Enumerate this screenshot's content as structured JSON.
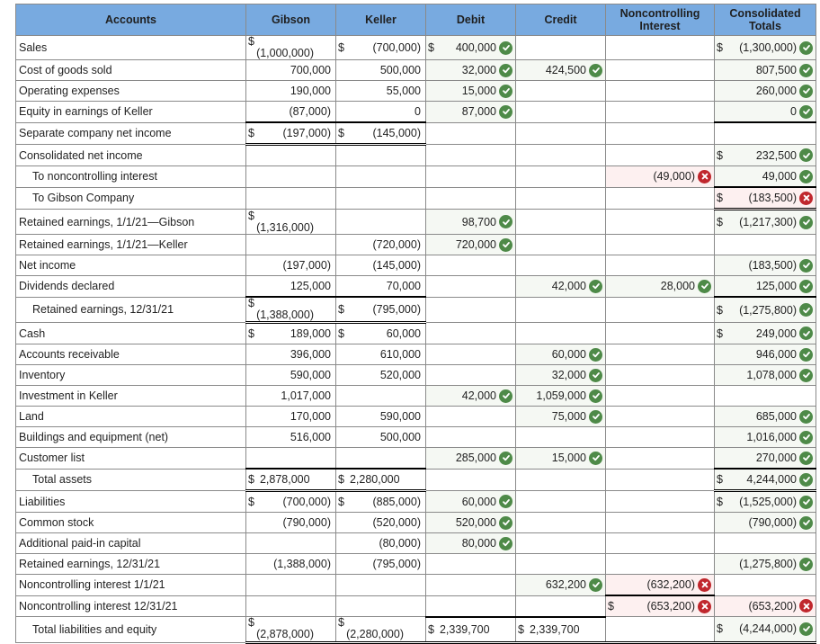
{
  "headers": {
    "accounts": "Accounts",
    "gibson": "Gibson",
    "keller": "Keller",
    "debit": "Debit",
    "credit": "Credit",
    "nci_line1": "Noncontrolling",
    "nci_line2": "Interest",
    "consolidated_line1": "Consolidated",
    "consolidated_line2": "Totals"
  },
  "status_colors": {
    "correct": "#4e8a48",
    "incorrect": "#c0272d",
    "header": "#78aae0"
  },
  "rows": [
    {
      "account": "Sales",
      "indent": false,
      "gibson": {
        "dollar": "$",
        "value": "(1,000,000)",
        "stacked": true
      },
      "keller": {
        "dollar": "$",
        "value": "(700,000)"
      },
      "debit": {
        "dollar": "$",
        "value": "400,000",
        "status": "correct"
      },
      "credit": null,
      "nci": null,
      "consolidated": {
        "dollar": "$",
        "value": "(1,300,000)",
        "status": "correct"
      }
    },
    {
      "account": "Cost of goods sold",
      "indent": false,
      "gibson": {
        "value": "700,000"
      },
      "keller": {
        "value": "500,000"
      },
      "debit": {
        "value": "32,000",
        "status": "correct"
      },
      "credit": {
        "value": "424,500",
        "status": "correct"
      },
      "nci": null,
      "consolidated": {
        "value": "807,500",
        "status": "correct"
      }
    },
    {
      "account": "Operating expenses",
      "indent": false,
      "gibson": {
        "value": "190,000"
      },
      "keller": {
        "value": "55,000"
      },
      "debit": {
        "value": "15,000",
        "status": "correct"
      },
      "credit": null,
      "nci": null,
      "consolidated": {
        "value": "260,000",
        "status": "correct"
      }
    },
    {
      "account": "Equity in earnings of Keller",
      "indent": false,
      "gibson": {
        "value": "(87,000)"
      },
      "keller": {
        "value": "0"
      },
      "debit": {
        "value": "87,000",
        "status": "correct"
      },
      "credit": null,
      "nci": null,
      "consolidated": {
        "value": "0",
        "status": "correct"
      }
    },
    {
      "account": "Separate company net income",
      "indent": false,
      "gibson": {
        "dollar": "$",
        "value": "(197,000)"
      },
      "keller": {
        "dollar": "$",
        "value": "(145,000)"
      },
      "debit": null,
      "credit": null,
      "nci": null,
      "consolidated": null
    },
    {
      "account": "Consolidated net income",
      "indent": false,
      "gibson": null,
      "keller": null,
      "debit": null,
      "credit": null,
      "nci": null,
      "consolidated": {
        "dollar": "$",
        "value": "232,500",
        "status": "correct"
      }
    },
    {
      "account": "To noncontrolling interest",
      "indent": true,
      "gibson": null,
      "keller": null,
      "debit": null,
      "credit": null,
      "nci": {
        "value": "(49,000)",
        "status": "incorrect"
      },
      "consolidated": {
        "value": "49,000",
        "status": "correct"
      }
    },
    {
      "account": "To Gibson Company",
      "indent": true,
      "gibson": null,
      "keller": null,
      "debit": null,
      "credit": null,
      "nci": null,
      "consolidated": {
        "dollar": "$",
        "value": "(183,500)",
        "status": "incorrect"
      }
    },
    {
      "account": "Retained earnings, 1/1/21—Gibson",
      "indent": false,
      "gibson": {
        "dollar": "$",
        "value": "(1,316,000)",
        "stacked": true
      },
      "keller": null,
      "debit": {
        "value": "98,700",
        "status": "correct"
      },
      "credit": null,
      "nci": null,
      "consolidated": {
        "dollar": "$",
        "value": "(1,217,300)",
        "status": "correct"
      }
    },
    {
      "account": "Retained earnings, 1/1/21—Keller",
      "indent": false,
      "gibson": null,
      "keller": {
        "value": "(720,000)"
      },
      "debit": {
        "value": "720,000",
        "status": "correct"
      },
      "credit": null,
      "nci": null,
      "consolidated": null
    },
    {
      "account": "Net income",
      "indent": false,
      "gibson": {
        "value": "(197,000)"
      },
      "keller": {
        "value": "(145,000)"
      },
      "debit": null,
      "credit": null,
      "nci": null,
      "consolidated": {
        "value": "(183,500)",
        "status": "correct"
      }
    },
    {
      "account": "Dividends declared",
      "indent": false,
      "gibson": {
        "value": "125,000"
      },
      "keller": {
        "value": "70,000"
      },
      "debit": null,
      "credit": {
        "value": "42,000",
        "status": "correct"
      },
      "nci": {
        "value": "28,000",
        "status": "correct"
      },
      "consolidated": {
        "value": "125,000",
        "status": "correct"
      }
    },
    {
      "account": "Retained earnings, 12/31/21",
      "indent": true,
      "gibson": {
        "dollar": "$",
        "value": "(1,388,000)",
        "stacked": true
      },
      "keller": {
        "dollar": "$",
        "value": "(795,000)"
      },
      "debit": null,
      "credit": null,
      "nci": null,
      "consolidated": {
        "dollar": "$",
        "value": "(1,275,800)",
        "status": "correct"
      }
    },
    {
      "account": "Cash",
      "indent": false,
      "gibson": {
        "dollar": "$",
        "value": "189,000"
      },
      "keller": {
        "dollar": "$",
        "value": "60,000"
      },
      "debit": null,
      "credit": null,
      "nci": null,
      "consolidated": {
        "dollar": "$",
        "value": "249,000",
        "status": "correct"
      }
    },
    {
      "account": "Accounts receivable",
      "indent": false,
      "gibson": {
        "value": "396,000"
      },
      "keller": {
        "value": "610,000"
      },
      "debit": null,
      "credit": {
        "value": "60,000",
        "status": "correct"
      },
      "nci": null,
      "consolidated": {
        "value": "946,000",
        "status": "correct"
      }
    },
    {
      "account": "Inventory",
      "indent": false,
      "gibson": {
        "value": "590,000"
      },
      "keller": {
        "value": "520,000"
      },
      "debit": null,
      "credit": {
        "value": "32,000",
        "status": "correct"
      },
      "nci": null,
      "consolidated": {
        "value": "1,078,000",
        "status": "correct"
      }
    },
    {
      "account": "Investment in Keller",
      "indent": false,
      "gibson": {
        "value": "1,017,000"
      },
      "keller": null,
      "debit": {
        "value": "42,000",
        "status": "correct"
      },
      "credit": {
        "value": "1,059,000",
        "status": "correct"
      },
      "nci": null,
      "consolidated": null
    },
    {
      "account": "Land",
      "indent": false,
      "gibson": {
        "value": "170,000"
      },
      "keller": {
        "value": "590,000"
      },
      "debit": null,
      "credit": {
        "value": "75,000",
        "status": "correct"
      },
      "nci": null,
      "consolidated": {
        "value": "685,000",
        "status": "correct"
      }
    },
    {
      "account": "Buildings and equipment (net)",
      "indent": false,
      "gibson": {
        "value": "516,000"
      },
      "keller": {
        "value": "500,000"
      },
      "debit": null,
      "credit": null,
      "nci": null,
      "consolidated": {
        "value": "1,016,000",
        "status": "correct"
      }
    },
    {
      "account": "Customer list",
      "indent": false,
      "gibson": null,
      "keller": null,
      "debit": {
        "value": "285,000",
        "status": "correct"
      },
      "credit": {
        "value": "15,000",
        "status": "correct"
      },
      "nci": null,
      "consolidated": {
        "value": "270,000",
        "status": "correct"
      }
    },
    {
      "account": "Total assets",
      "indent": true,
      "gibson": {
        "dollar": "$",
        "value": "2,878,000",
        "tight": true
      },
      "keller": {
        "dollar": "$",
        "value": "2,280,000",
        "tight": true
      },
      "debit": null,
      "credit": null,
      "nci": null,
      "consolidated": {
        "dollar": "$",
        "value": "4,244,000",
        "status": "correct"
      }
    },
    {
      "account": "Liabilities",
      "indent": false,
      "gibson": {
        "dollar": "$",
        "value": "(700,000)"
      },
      "keller": {
        "dollar": "$",
        "value": "(885,000)"
      },
      "debit": {
        "value": "60,000",
        "status": "correct"
      },
      "credit": null,
      "nci": null,
      "consolidated": {
        "dollar": "$",
        "value": "(1,525,000)",
        "status": "correct"
      }
    },
    {
      "account": "Common stock",
      "indent": false,
      "gibson": {
        "value": "(790,000)"
      },
      "keller": {
        "value": "(520,000)"
      },
      "debit": {
        "value": "520,000",
        "status": "correct"
      },
      "credit": null,
      "nci": null,
      "consolidated": {
        "value": "(790,000)",
        "status": "correct"
      }
    },
    {
      "account": "Additional paid-in capital",
      "indent": false,
      "gibson": null,
      "keller": {
        "value": "(80,000)"
      },
      "debit": {
        "value": "80,000",
        "status": "correct"
      },
      "credit": null,
      "nci": null,
      "consolidated": null
    },
    {
      "account": "Retained earnings, 12/31/21",
      "indent": false,
      "gibson": {
        "value": "(1,388,000)"
      },
      "keller": {
        "value": "(795,000)"
      },
      "debit": null,
      "credit": null,
      "nci": null,
      "consolidated": {
        "value": "(1,275,800)",
        "status": "correct"
      }
    },
    {
      "account": "Noncontrolling interest 1/1/21",
      "indent": false,
      "gibson": null,
      "keller": null,
      "debit": null,
      "credit": {
        "value": "632,200",
        "status": "correct"
      },
      "nci": {
        "value": "(632,200)",
        "status": "incorrect"
      },
      "consolidated": null
    },
    {
      "account": "Noncontrolling interest 12/31/21",
      "indent": false,
      "gibson": null,
      "keller": null,
      "debit": null,
      "credit": null,
      "nci": {
        "dollar": "$",
        "value": "(653,200)",
        "status": "incorrect"
      },
      "consolidated": {
        "value": "(653,200)",
        "status": "incorrect"
      }
    },
    {
      "account": "Total liabilities and equity",
      "indent": true,
      "gibson": {
        "dollar": "$",
        "value": "(2,878,000)",
        "stacked": true
      },
      "keller": {
        "dollar": "$",
        "value": "(2,280,000)",
        "stacked": true
      },
      "debit": {
        "dollar": "$",
        "value": "2,339,700",
        "tight": true
      },
      "credit": {
        "dollar": "$",
        "value": "2,339,700",
        "tight": true
      },
      "nci": null,
      "consolidated": {
        "dollar": "$",
        "value": "(4,244,000)",
        "status": "correct"
      }
    }
  ]
}
